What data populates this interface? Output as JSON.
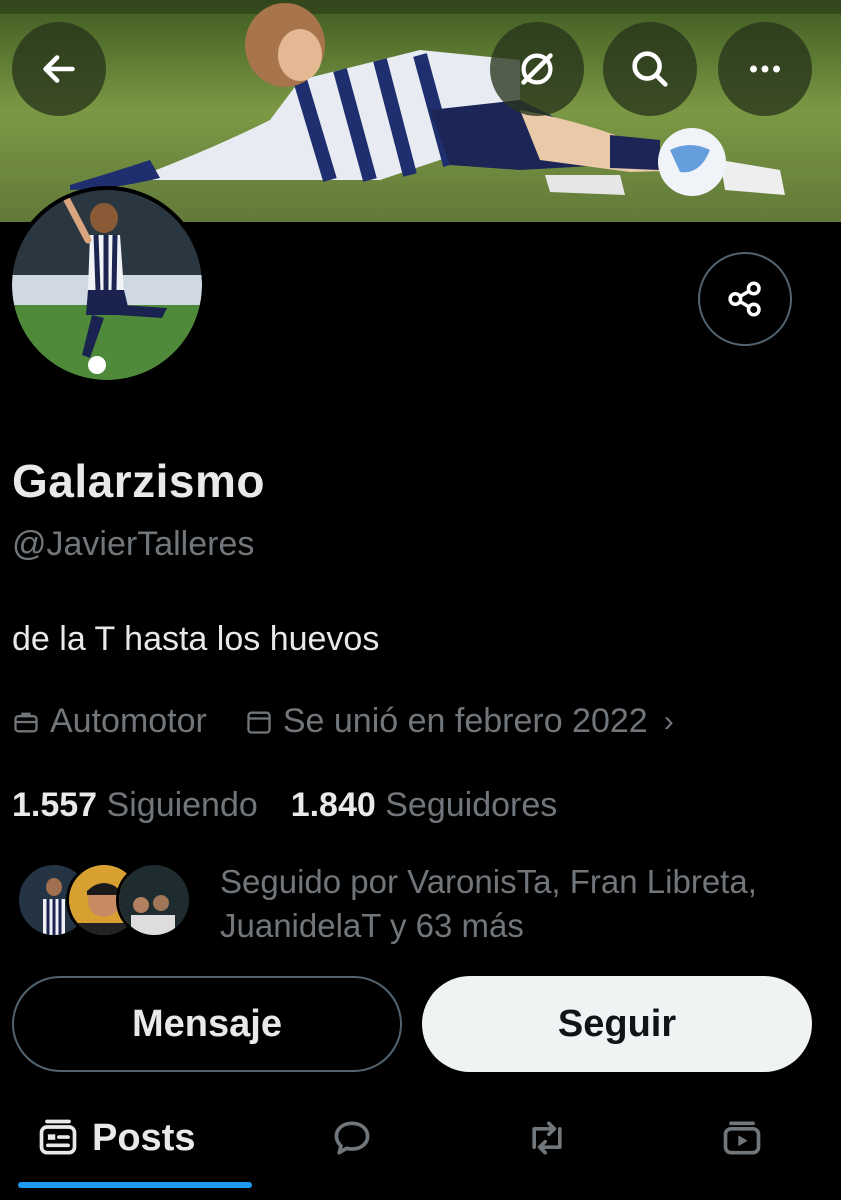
{
  "profile": {
    "display_name": "Galarzismo",
    "handle": "@JavierTalleres",
    "bio": "de la T hasta los huevos",
    "location": "Automotor",
    "joined": "Se unió en febrero 2022",
    "following_count": "1.557",
    "following_label": "Siguiendo",
    "followers_count": "1.840",
    "followers_label": "Seguidores",
    "followed_by": "Seguido por VaronisTa, Fran Libreta, JuanidelaT y 63 más"
  },
  "actions": {
    "message_label": "Mensaje",
    "follow_label": "Seguir"
  },
  "tabs": [
    {
      "label": "Posts",
      "icon": "posts-icon"
    },
    {
      "icon": "replies-icon"
    },
    {
      "icon": "retweet-icon"
    },
    {
      "icon": "media-icon"
    }
  ],
  "top_bar": {
    "icons": [
      "back-arrow-icon",
      "grok-icon",
      "search-icon",
      "more-icon"
    ]
  },
  "colors": {
    "background": "#000000",
    "text_primary": "#e7e9ea",
    "text_secondary": "#71767b",
    "accent": "#1d9bf0",
    "follow_button_bg": "#eff3f4"
  }
}
